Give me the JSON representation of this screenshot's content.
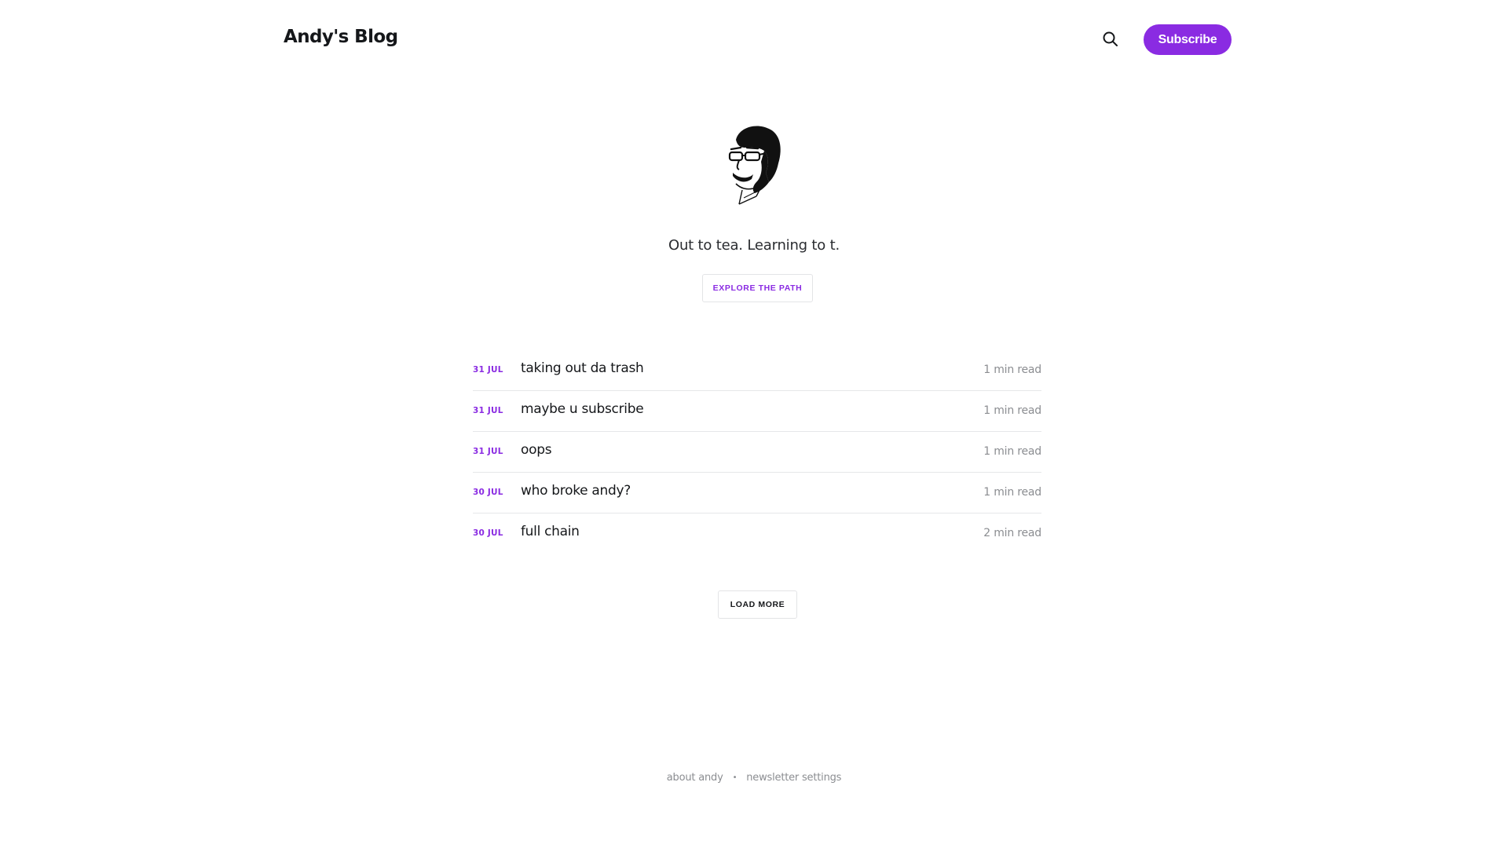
{
  "header": {
    "site_title": "Andy's Blog",
    "search_icon": "search-icon",
    "subscribe_label": "Subscribe"
  },
  "colors": {
    "accent": "#8a2be2",
    "text": "#15171a",
    "muted": "#8b8d91",
    "divider": "#e6e7e9"
  },
  "hero": {
    "avatar_icon": "portrait-illustration",
    "tagline": "Out to tea. Learning to t.",
    "cta_label": "EXPLORE THE PATH"
  },
  "posts": [
    {
      "date": "31 JUL",
      "title": "taking out da trash",
      "read_time": "1 min read"
    },
    {
      "date": "31 JUL",
      "title": "maybe u subscribe",
      "read_time": "1 min read"
    },
    {
      "date": "31 JUL",
      "title": "oops",
      "read_time": "1 min read"
    },
    {
      "date": "30 JUL",
      "title": "who broke andy?",
      "read_time": "1 min read"
    },
    {
      "date": "30 JUL",
      "title": "full chain",
      "read_time": "2 min read"
    }
  ],
  "load_more_label": "LOAD MORE",
  "footer": {
    "links": [
      "about andy",
      "newsletter settings"
    ],
    "separator": "•"
  }
}
